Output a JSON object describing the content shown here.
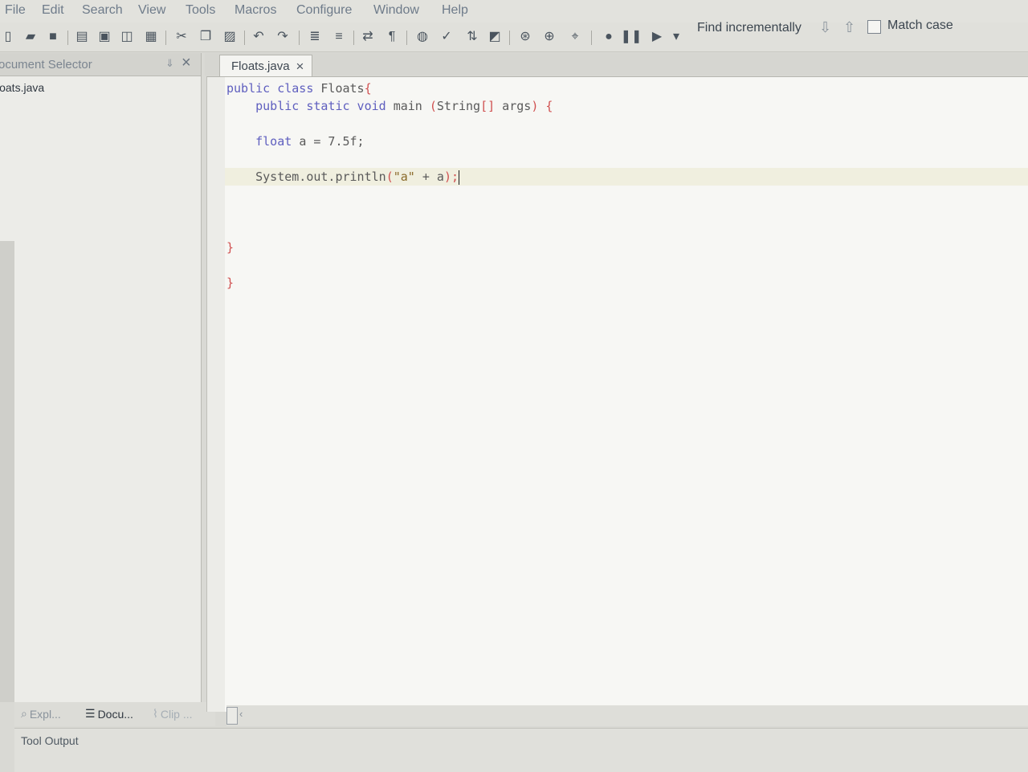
{
  "menu": [
    "File",
    "Edit",
    "Search",
    "View",
    "Tools",
    "Macros",
    "Configure",
    "Window",
    "Help"
  ],
  "find": {
    "label": "Find incrementally",
    "match_case": "Match case"
  },
  "document_selector": {
    "title": "ocument Selector",
    "files": [
      "loats.java"
    ]
  },
  "editor": {
    "tab_label": "Floats.java",
    "lines": [
      [
        {
          "t": "public class ",
          "c": "kw"
        },
        {
          "t": "Floats",
          "c": "pl"
        },
        {
          "t": "{",
          "c": "br"
        }
      ],
      [
        {
          "t": "    public static void ",
          "c": "kw"
        },
        {
          "t": "main ",
          "c": "pl"
        },
        {
          "t": "(",
          "c": "br"
        },
        {
          "t": "String",
          "c": "pl"
        },
        {
          "t": "[]",
          "c": "br"
        },
        {
          "t": " args",
          "c": "pl"
        },
        {
          "t": ") {",
          "c": "br"
        }
      ],
      [],
      [
        {
          "t": "    float ",
          "c": "kw"
        },
        {
          "t": "a = 7.5f;",
          "c": "pl"
        }
      ],
      [],
      [
        {
          "t": "    System.out.println",
          "c": "pl"
        },
        {
          "t": "(",
          "c": "br"
        },
        {
          "t": "\"a\"",
          "c": "st"
        },
        {
          "t": " + a",
          "c": "pl"
        },
        {
          "t": ");",
          "c": "br"
        }
      ],
      [],
      [],
      [],
      [
        {
          "t": "}",
          "c": "br"
        }
      ],
      [],
      [
        {
          "t": "}",
          "c": "br"
        }
      ]
    ]
  },
  "bottom_tabs": [
    {
      "label": "Expl...",
      "icon": "search-folder-icon"
    },
    {
      "label": "Docu...",
      "icon": "documents-icon"
    },
    {
      "label": "Clip ...",
      "icon": "clip-icon"
    }
  ],
  "tool_output": "Tool Output"
}
